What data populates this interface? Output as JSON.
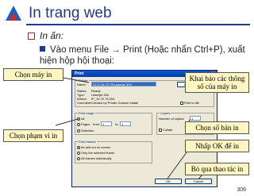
{
  "slide": {
    "title": "In trang web",
    "subheading": "In ấn:",
    "instruction": "Vào menu File → Print (Hoặc nhấn Ctrl+P), xuất hiện hộp hội thoại:",
    "page_number": "306"
  },
  "print_dialog": {
    "title": "Print",
    "printer_group": "Printer",
    "name_label": "Name:",
    "name_value": "\\\\172.16.70.75\\Laserjet 304",
    "properties_button": "Properties...",
    "status_label": "Status:",
    "status_value": "Ready",
    "type_label": "Type:",
    "type_value": "Laserjet 304",
    "where_label": "Where:",
    "where_value": "IP_10.70.75.204",
    "comment_label": "Comment:",
    "comment_value": "Created by Printer Custom Install",
    "print_to_file": "Print to file",
    "page_range_group": "Print range",
    "all_option": "All",
    "pages_option": "Pages",
    "from_label": "from:",
    "from_value": "1",
    "to_label": "to:",
    "to_value": "1",
    "selection_option": "Selection",
    "copies_group": "Copies",
    "copies_label": "Number of copies:",
    "copies_value": "1",
    "collate_label": "Collate",
    "print_frames_group": "Print frames",
    "frames_opt1": "As laid out on screen",
    "frames_opt2": "Only the selected frame",
    "frames_opt3": "All frames individually",
    "ok_button": "OK",
    "cancel_button": "Cancel"
  },
  "callouts": {
    "choose_printer": "Chọn máy in",
    "declare_printer": "Khai báo các thông số của máy in",
    "choose_copies": "Chọn số bản in",
    "choose_range": "Chọn phạm vi in",
    "press_ok": "Nhấp OK để in",
    "cancel_print": "Bỏ qua thao tác in"
  },
  "colors": {
    "title": "#1f3a8a",
    "callout_bg": "#fdf6c3",
    "bullet": "#b71c1c"
  }
}
